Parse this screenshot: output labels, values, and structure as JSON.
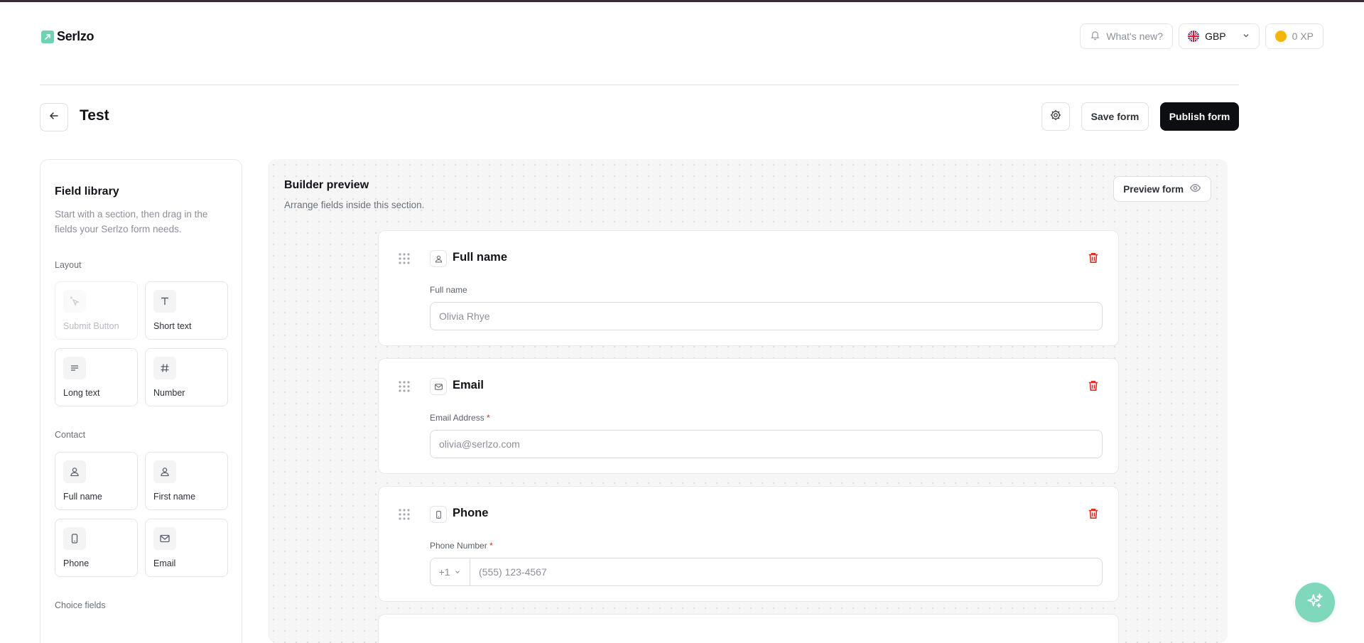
{
  "brand": {
    "name": "Serlzo"
  },
  "top_actions": {
    "whats_new": "What's new?",
    "currency": "GBP",
    "xp": "0 XP"
  },
  "page": {
    "title": "Test",
    "save_label": "Save form",
    "publish_label": "Publish form"
  },
  "library": {
    "title": "Field library",
    "description": "Start with a section, then drag in the fields your Serlzo form needs.",
    "sections": [
      {
        "label": "Layout",
        "tiles": [
          "Submit Button",
          "Short text",
          "Long text",
          "Number"
        ]
      },
      {
        "label": "Contact",
        "tiles": [
          "Full name",
          "First name",
          "Phone",
          "Email"
        ]
      },
      {
        "label": "Choice fields",
        "tiles": []
      }
    ]
  },
  "builder": {
    "title": "Builder preview",
    "subtitle": "Arrange fields inside this section.",
    "preview_label": "Preview form",
    "fields": [
      {
        "title": "Full name",
        "label": "Full name",
        "required": false,
        "placeholder": "Olivia Rhye",
        "icon": "user-icon"
      },
      {
        "title": "Email",
        "label": "Email Address",
        "required": true,
        "placeholder": "olivia@serlzo.com",
        "icon": "mail-icon"
      },
      {
        "title": "Phone",
        "label": "Phone Number",
        "required": true,
        "country_code": "+1",
        "placeholder": "(555) 123-4567",
        "icon": "phone-icon"
      }
    ],
    "required_mark": "*"
  },
  "colors": {
    "accent": "#6fd3b3",
    "primary_button": "#0c0e12",
    "danger": "#d92d20"
  }
}
